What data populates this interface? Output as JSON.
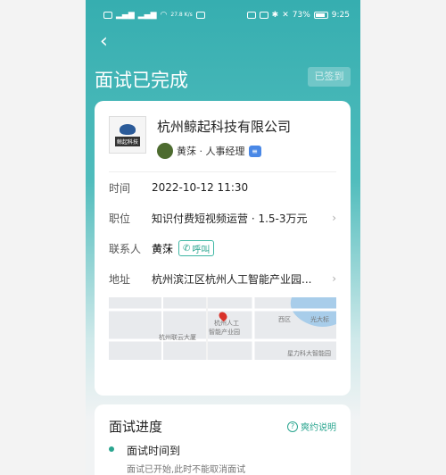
{
  "status_bar": {
    "left_icons": [
      "sim-icon",
      "signal-icon",
      "signal-icon",
      "wifi-icon"
    ],
    "speed": "27.8\nK/s",
    "battery_percent": "73%",
    "time": "9:25"
  },
  "header": {
    "title": "面试已完成",
    "signed_label": "已签到"
  },
  "company": {
    "name": "杭州鲸起科技有限公司",
    "logo_text": "鲸起科技",
    "contact_line": "黄莯 · 人事经理"
  },
  "details": {
    "time_label": "时间",
    "time_value": "2022-10-12 11:30",
    "position_label": "职位",
    "position_value": "知识付费短视频运营 · 1.5-3万元",
    "contact_label": "联系人",
    "contact_value": "黄莯",
    "call_label": "呼叫",
    "address_label": "地址",
    "address_value": "杭州滨江区杭州人工智能产业园..."
  },
  "map": {
    "labels": [
      "杭州人工",
      "智能产业园",
      "杭州联云大厦",
      "西区",
      "光大标",
      "星力科大智能园"
    ]
  },
  "progress": {
    "title": "面试进度",
    "rules_label": "爽约说明",
    "step_title": "面试时间到",
    "step_desc": "面试已开始,此时不能取消面试"
  }
}
